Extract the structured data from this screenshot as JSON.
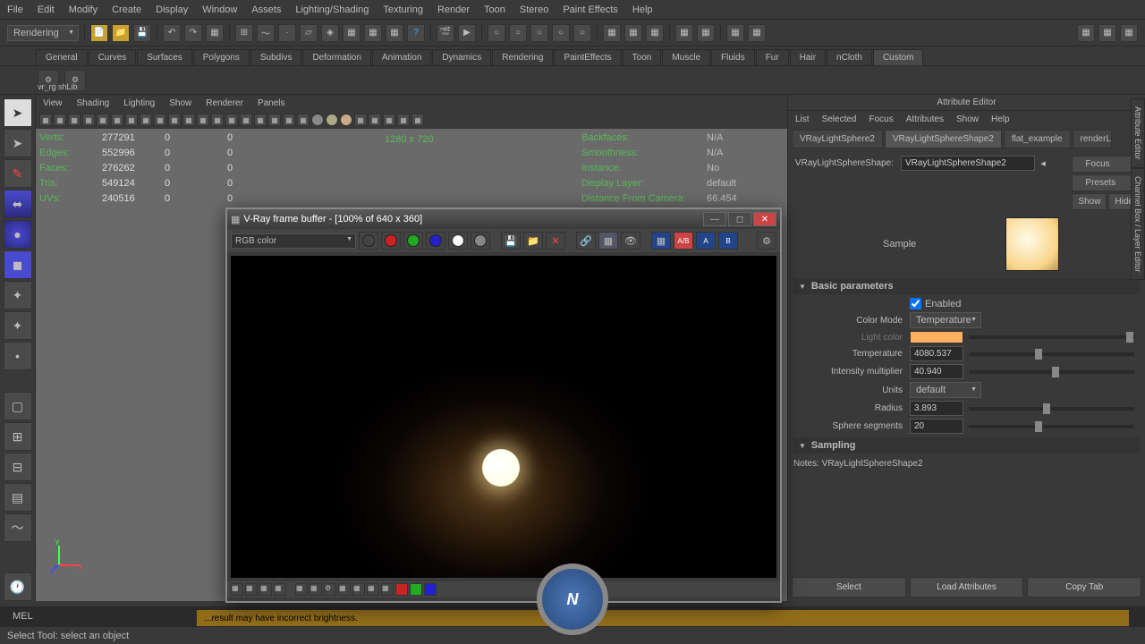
{
  "menubar": [
    "File",
    "Edit",
    "Modify",
    "Create",
    "Display",
    "Window",
    "Assets",
    "Lighting/Shading",
    "Texturing",
    "Render",
    "Toon",
    "Stereo",
    "Paint Effects",
    "Help"
  ],
  "workspace_dropdown": "Rendering",
  "shelf_tabs": [
    "General",
    "Curves",
    "Surfaces",
    "Polygons",
    "Subdivs",
    "Deformation",
    "Animation",
    "Dynamics",
    "Rendering",
    "PaintEffects",
    "Toon",
    "Muscle",
    "Fluids",
    "Fur",
    "Hair",
    "nCloth",
    "Custom"
  ],
  "shelf_active": "Custom",
  "shelf_item": "vr_rg shLib",
  "viewport": {
    "menus": [
      "View",
      "Shading",
      "Lighting",
      "Show",
      "Renderer",
      "Panels"
    ],
    "resolution": "1280 x 720",
    "stats_left": [
      {
        "label": "Verts:",
        "v1": "277291",
        "v2": "0",
        "v3": "0"
      },
      {
        "label": "Edges:",
        "v1": "552996",
        "v2": "0",
        "v3": "0"
      },
      {
        "label": "Faces:",
        "v1": "276262",
        "v2": "0",
        "v3": "0"
      },
      {
        "label": "Tris:",
        "v1": "549124",
        "v2": "0",
        "v3": "0"
      },
      {
        "label": "UVs:",
        "v1": "240516",
        "v2": "0",
        "v3": "0"
      }
    ],
    "stats_right": [
      {
        "label": "Backfaces:",
        "val": "N/A"
      },
      {
        "label": "Smoothness:",
        "val": "N/A"
      },
      {
        "label": "Instance:",
        "val": "No"
      },
      {
        "label": "Display Layer:",
        "val": "default"
      },
      {
        "label": "Distance From Camera:",
        "val": "66.454"
      }
    ]
  },
  "vray": {
    "title": "V-Ray frame buffer - [100% of 640 x 360]",
    "channel": "RGB color"
  },
  "attr_editor": {
    "title": "Attribute Editor",
    "menus": [
      "List",
      "Selected",
      "Focus",
      "Attributes",
      "Show",
      "Help"
    ],
    "tabs": [
      "VRayLightSphere2",
      "VRayLightSphereShape2",
      "flat_example",
      "renderL"
    ],
    "active_tab": "VRayLightSphereShape2",
    "name_label": "VRayLightSphereShape:",
    "name_value": "VRayLightSphereShape2",
    "focus_btn": "Focus",
    "presets_btn": "Presets",
    "show_btn": "Show",
    "hide_btn": "Hide",
    "sample_label": "Sample",
    "section_basic": "Basic parameters",
    "enabled_label": "Enabled",
    "enabled": true,
    "colormode_label": "Color Mode",
    "colormode": "Temperature",
    "lightcolor_label": "Light color",
    "lightcolor": "#ffb060",
    "temperature_label": "Temperature",
    "temperature": "4080.537",
    "intensity_label": "Intensity multiplier",
    "intensity": "40.940",
    "units_label": "Units",
    "units": "default",
    "radius_label": "Radius",
    "radius": "3.893",
    "segments_label": "Sphere segments",
    "segments": "20",
    "section_sampling": "Sampling",
    "notes_label": "Notes: VRayLightSphereShape2",
    "buttons": [
      "Select",
      "Load Attributes",
      "Copy Tab"
    ]
  },
  "side_tabs": [
    "Attribute Editor",
    "Channel Box / Layer Editor"
  ],
  "status": {
    "mel": "MEL",
    "hint": "Select Tool: select an object",
    "warning": "...result may have incorrect brightness."
  }
}
